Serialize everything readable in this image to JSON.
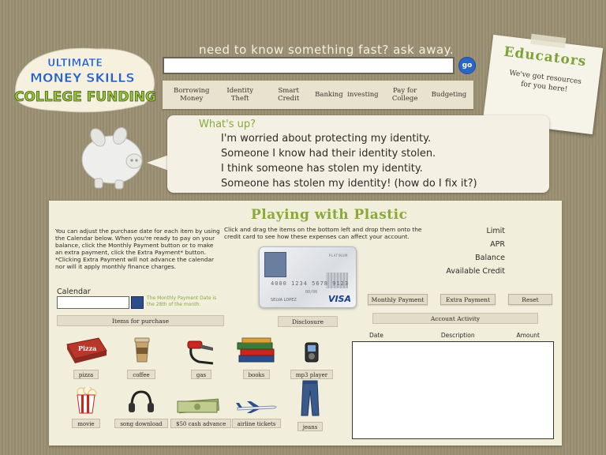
{
  "logo": {
    "line1": "ULTIMATE",
    "line2": "MONEY SKILLS",
    "line3": "COLLEGE FUNDING"
  },
  "search": {
    "prompt": "need to know something fast? ask away.",
    "value": "",
    "go_label": "go"
  },
  "nav": [
    {
      "label": "Borrowing Money"
    },
    {
      "label": "Identity Theft"
    },
    {
      "label": "Smart Credit"
    },
    {
      "label": "Banking"
    },
    {
      "label": "investing"
    },
    {
      "label": "Pay for College"
    },
    {
      "label": "Budgeting"
    }
  ],
  "educators": {
    "title": "Educators",
    "text": "We've got resources for you here!"
  },
  "bubble": {
    "heading": "What's up?",
    "questions": [
      "I'm worried about protecting my identity.",
      "Someone I know had their identity stolen.",
      "I think someone has stolen my identity.",
      "Someone has stolen my identity! (how do I fix it?)"
    ]
  },
  "game": {
    "title": "Playing with Plastic",
    "instructions_left": "You can adjust the purchase date for each item by using the Calendar below. When you're ready to pay on your balance, click the Monthly Payment button or to make an extra payment, click the Extra Payment* button. *Clicking Extra Payment will not advance the calendar nor will it apply monthly finance charges.",
    "instructions_right": "Click and drag the items on the bottom left and drop them onto the credit card to see how these expenses can affect your account.",
    "card": {
      "number": "4000 1234 5678 9123",
      "expires": "00/00",
      "name": "SELVA LOPEZ",
      "tier": "PLATINUM",
      "brand": "VISA"
    },
    "stats": {
      "limit": "Limit",
      "apr": "APR",
      "balance": "Balance",
      "available": "Available Credit"
    },
    "buttons": {
      "monthly": "Monthly Payment",
      "extra": "Extra Payment",
      "reset": "Reset"
    },
    "calendar": {
      "label": "Calendar",
      "value": "",
      "note": "The Monthly Payment Date is the 28th of the month."
    },
    "items_header": "Items for purchase",
    "disclosure": "Disclosure",
    "activity": {
      "title": "Account Activity",
      "columns": [
        "Date",
        "Description",
        "Amount"
      ]
    },
    "items": [
      {
        "label": "pizza"
      },
      {
        "label": "coffee"
      },
      {
        "label": "gas"
      },
      {
        "label": "books"
      },
      {
        "label": "mp3 player"
      },
      {
        "label": "movie"
      },
      {
        "label": "song download"
      },
      {
        "label": "$50 cash advance"
      },
      {
        "label": "airline tickets"
      },
      {
        "label": "jeans"
      }
    ]
  }
}
